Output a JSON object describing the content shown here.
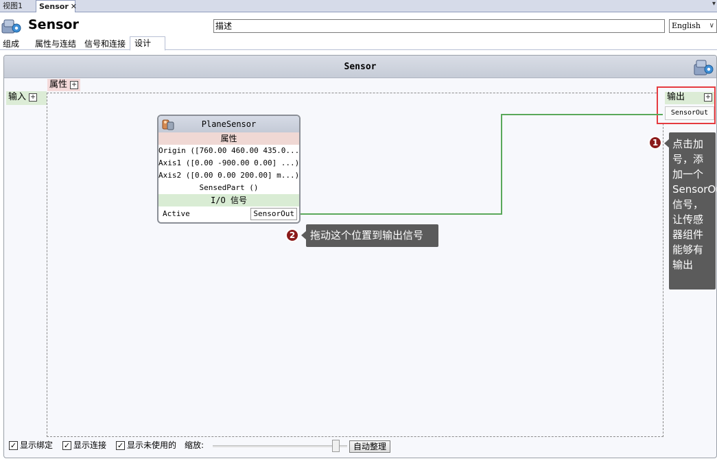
{
  "doc_tabs": {
    "view_tab": "视图1",
    "active_tab": "Sensor",
    "close_glyph": "✕"
  },
  "header": {
    "title": "Sensor",
    "description_value": "描述",
    "language": "English"
  },
  "editor_tabs": [
    "组成",
    "属性与连结",
    "信号和连接",
    "设计"
  ],
  "panel": {
    "title": "Sensor",
    "properties_label": "属性",
    "inputs_label": "输入",
    "outputs_label": "输出",
    "plus_glyph": "+",
    "output_signal": "SensorOut"
  },
  "node": {
    "title": "PlaneSensor",
    "properties_header": "属性",
    "properties": [
      "Origin ([760.00 460.00 435.0...)",
      "Axis1 ([0.00 -900.00 0.00] ...)",
      "Axis2 ([0.00 0.00 200.00] m...)",
      "SensedPart ()"
    ],
    "io_header": "I/O 信号",
    "input_signal": "Active",
    "output_signal": "SensorOut"
  },
  "callouts": [
    {
      "badge": "1",
      "text": "点击加号，添加一个SensorOut信号，让传感器组件能够有输出"
    },
    {
      "badge": "2",
      "text": "拖动这个位置到输出信号"
    }
  ],
  "footer": {
    "show_bindings": "显示绑定",
    "show_connections": "显示连接",
    "show_unused": "显示未使用的",
    "zoom_label": "缩放:",
    "zoom_level": 0.94,
    "auto_arrange": "自动整理",
    "check_glyph": "✓"
  },
  "colors": {
    "highlight_box": "#e53a3f",
    "connection_line": "#5aa85a",
    "callout_bg": "#5b5b5b",
    "badge_bg": "#8b1a1a"
  },
  "icons": {
    "component": "component-gear-icon",
    "node": "plane-sensor-icon"
  }
}
